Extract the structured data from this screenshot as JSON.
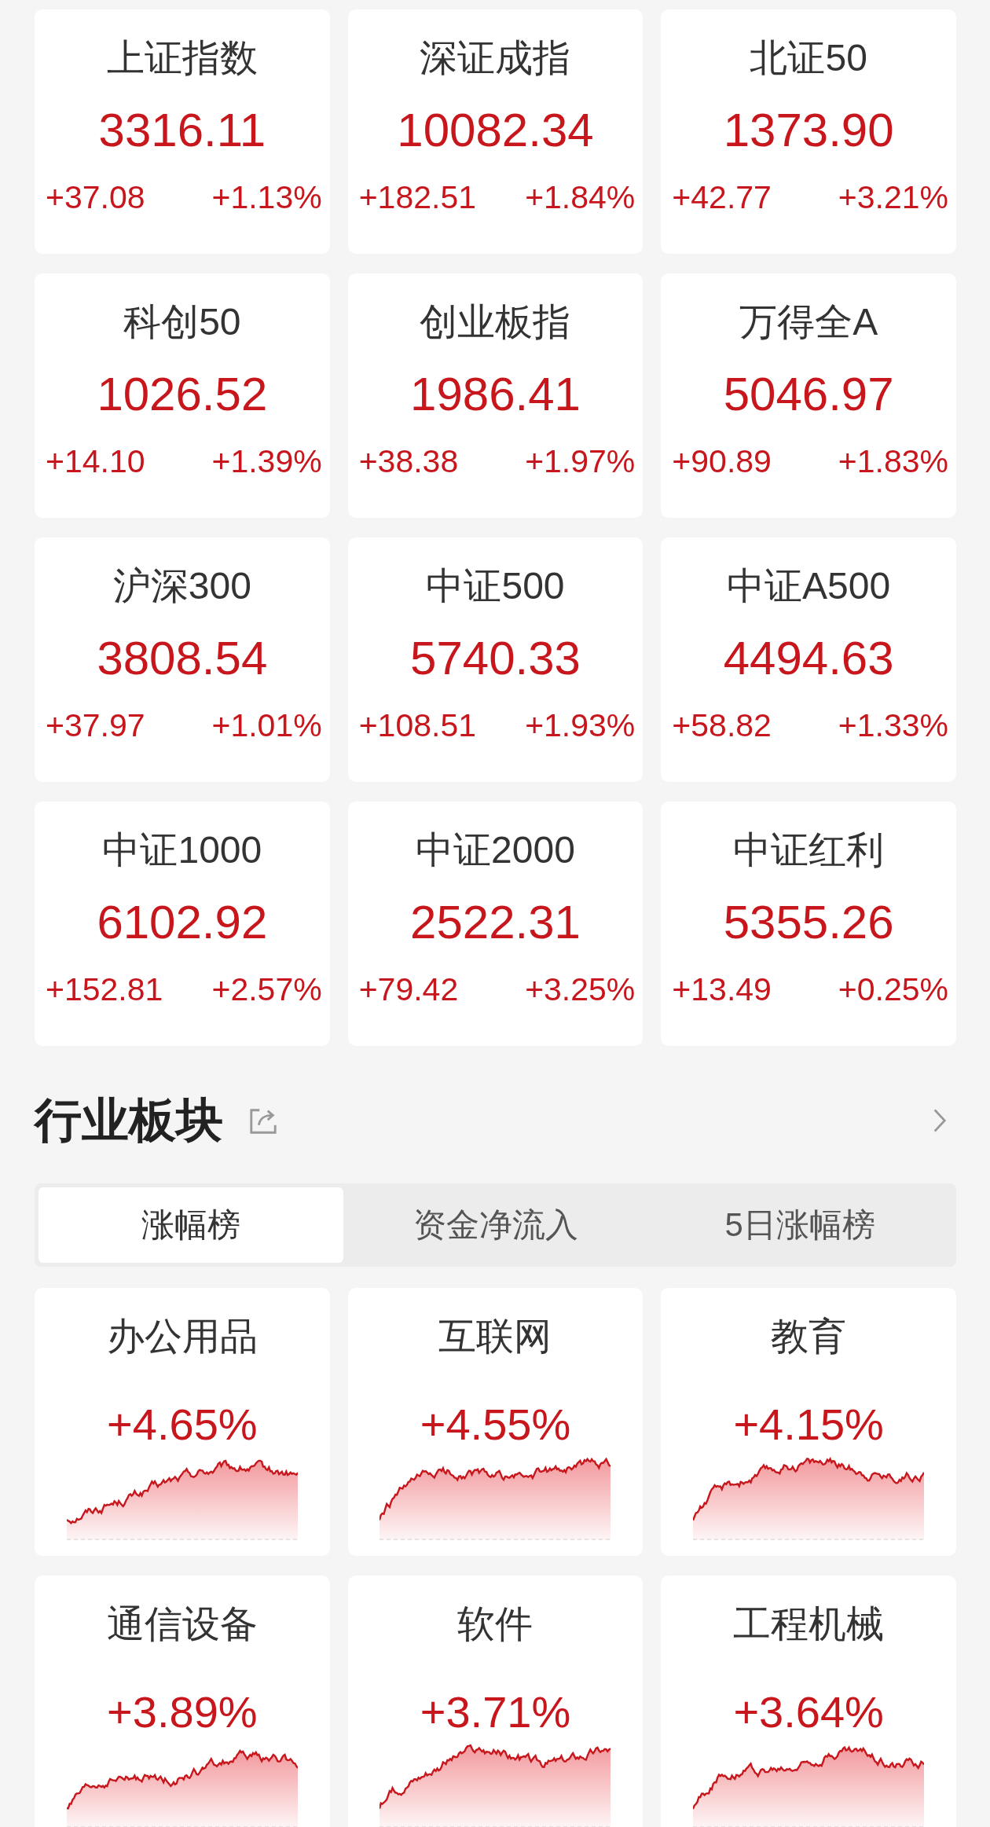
{
  "indices": [
    {
      "name": "上证指数",
      "value": "3316.11",
      "change": "+37.08",
      "change_pct": "+1.13%"
    },
    {
      "name": "深证成指",
      "value": "10082.34",
      "change": "+182.51",
      "change_pct": "+1.84%"
    },
    {
      "name": "北证50",
      "value": "1373.90",
      "change": "+42.77",
      "change_pct": "+3.21%"
    },
    {
      "name": "科创50",
      "value": "1026.52",
      "change": "+14.10",
      "change_pct": "+1.39%"
    },
    {
      "name": "创业板指",
      "value": "1986.41",
      "change": "+38.38",
      "change_pct": "+1.97%"
    },
    {
      "name": "万得全A",
      "value": "5046.97",
      "change": "+90.89",
      "change_pct": "+1.83%"
    },
    {
      "name": "沪深300",
      "value": "3808.54",
      "change": "+37.97",
      "change_pct": "+1.01%"
    },
    {
      "name": "中证500",
      "value": "5740.33",
      "change": "+108.51",
      "change_pct": "+1.93%"
    },
    {
      "name": "中证A500",
      "value": "4494.63",
      "change": "+58.82",
      "change_pct": "+1.33%"
    },
    {
      "name": "中证1000",
      "value": "6102.92",
      "change": "+152.81",
      "change_pct": "+2.57%"
    },
    {
      "name": "中证2000",
      "value": "2522.31",
      "change": "+79.42",
      "change_pct": "+3.25%"
    },
    {
      "name": "中证红利",
      "value": "5355.26",
      "change": "+13.49",
      "change_pct": "+0.25%"
    }
  ],
  "sector_panel": {
    "title": "行业板块",
    "tabs": [
      {
        "label": "涨幅榜",
        "selected": true
      },
      {
        "label": "资金净流入",
        "selected": false
      },
      {
        "label": "5日涨幅榜",
        "selected": false
      }
    ],
    "sectors": [
      {
        "name": "办公用品",
        "change_pct": "+4.65%"
      },
      {
        "name": "互联网",
        "change_pct": "+4.55%"
      },
      {
        "name": "教育",
        "change_pct": "+4.15%"
      },
      {
        "name": "通信设备",
        "change_pct": "+3.89%"
      },
      {
        "name": "软件",
        "change_pct": "+3.71%"
      },
      {
        "name": "工程机械",
        "change_pct": "+3.64%"
      }
    ]
  }
}
